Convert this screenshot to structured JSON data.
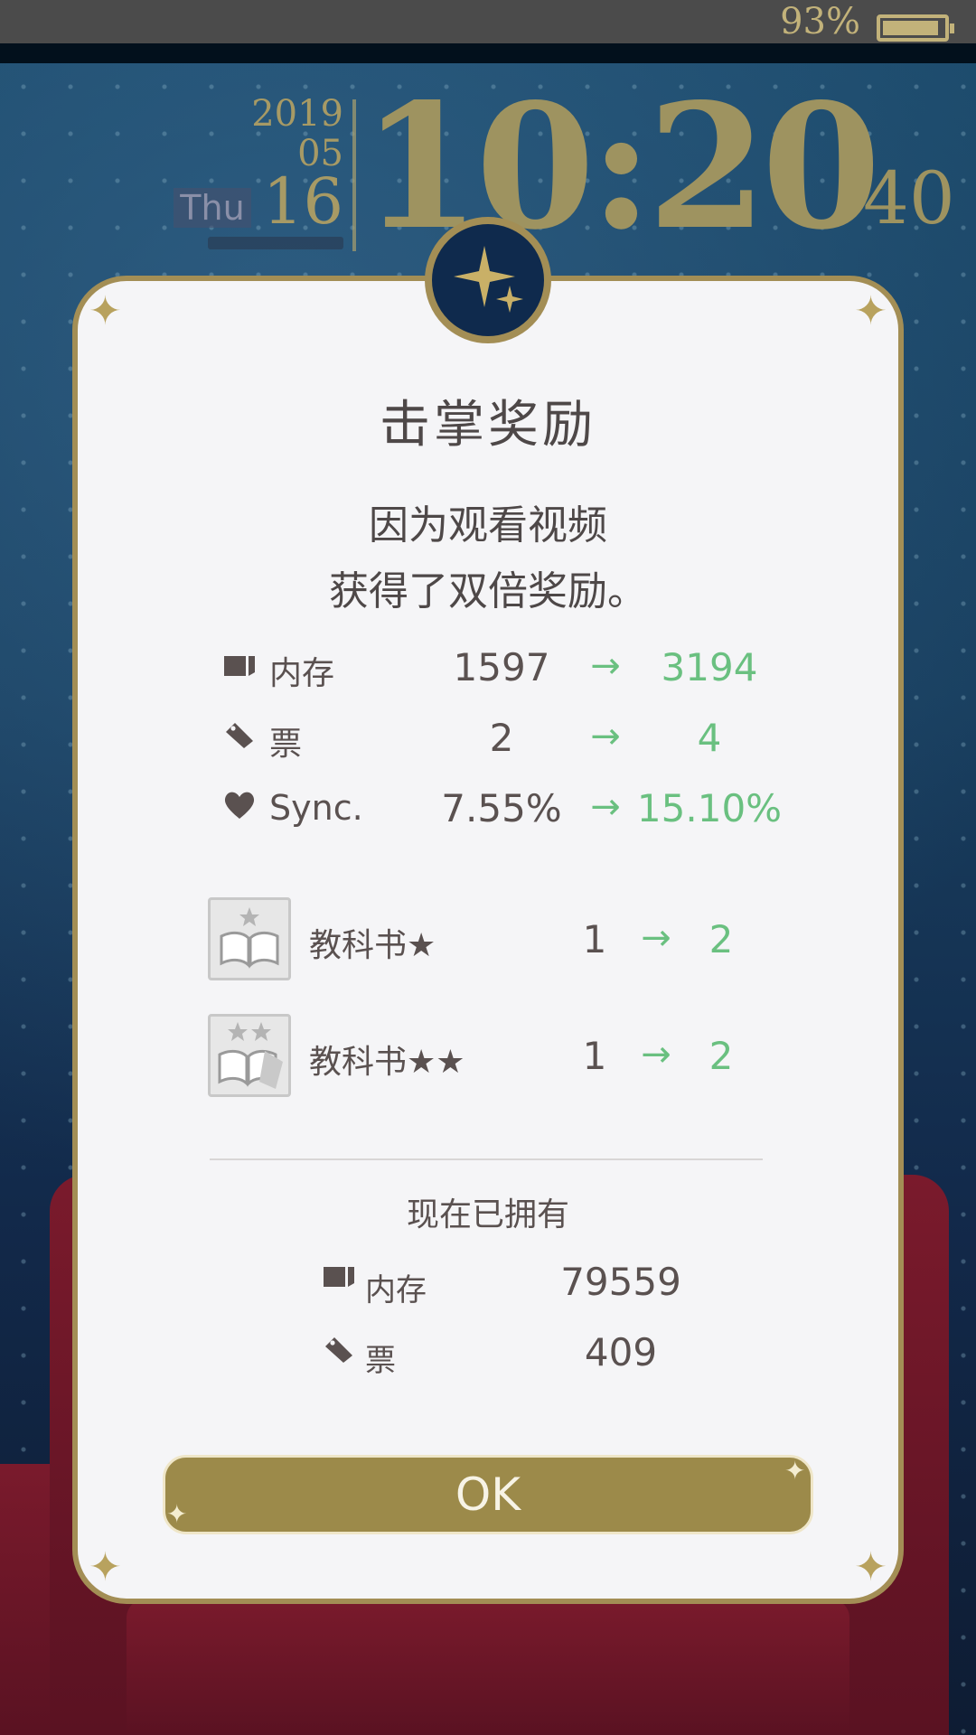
{
  "status_bar": {
    "battery_percent": "93%",
    "battery_level": 0.93
  },
  "clock": {
    "year": "2019",
    "month": "05",
    "day": "16",
    "weekday": "Thu",
    "time": "10:20",
    "seconds": "40"
  },
  "dialog": {
    "title": "击掌奖励",
    "message_line1": "因为观看视频",
    "message_line2": "获得了双倍奖励。",
    "rewards": [
      {
        "icon": "memory-icon",
        "label": "内存",
        "from": "1597",
        "arrow": "→",
        "to": "3194"
      },
      {
        "icon": "ticket-icon",
        "label": "票",
        "from": "2",
        "arrow": "→",
        "to": "4"
      },
      {
        "icon": "heart-icon",
        "label": "Sync.",
        "from": "7.55%",
        "arrow": "→",
        "to": "15.10%"
      }
    ],
    "items": [
      {
        "icon": "textbook-1star-icon",
        "label": "教科书★",
        "from": "1",
        "arrow": "→",
        "to": "2"
      },
      {
        "icon": "textbook-2star-icon",
        "label": "教科书★★",
        "from": "1",
        "arrow": "→",
        "to": "2"
      }
    ],
    "owned_title": "现在已拥有",
    "owned": [
      {
        "icon": "memory-icon",
        "label": "内存",
        "value": "79559"
      },
      {
        "icon": "ticket-icon",
        "label": "票",
        "value": "409"
      }
    ],
    "ok_label": "OK"
  },
  "colors": {
    "gold": "#a38e55",
    "green": "#6ac080",
    "text": "#5a5150",
    "dialog_bg": "#f5f5f7"
  }
}
